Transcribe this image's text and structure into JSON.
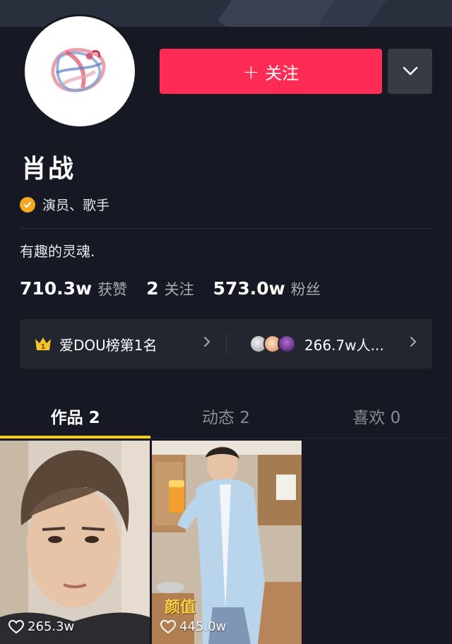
{
  "profile": {
    "name": "肖战",
    "verified_label": "演员、歌手",
    "bio": "有趣的灵魂."
  },
  "actions": {
    "follow_label": "关注"
  },
  "stats": [
    {
      "value": "710.3w",
      "label": "获赞"
    },
    {
      "value": "2",
      "label": "关注"
    },
    {
      "value": "573.0w",
      "label": "粉丝"
    }
  ],
  "rank": {
    "left_label": "爱DOU榜第1名",
    "right_label": "266.7w人..."
  },
  "tabs": [
    {
      "label": "作品 2",
      "active": true
    },
    {
      "label": "动态 2",
      "active": false
    },
    {
      "label": "喜欢 0",
      "active": false
    }
  ],
  "videos": [
    {
      "likes": "265.3w"
    },
    {
      "likes": "445.0w",
      "overlay_text": "颜值"
    }
  ],
  "colors": {
    "background": "#161823",
    "follow_button": "#fe2c55",
    "tab_indicator": "#face15",
    "verify_badge": "#f7a823"
  }
}
